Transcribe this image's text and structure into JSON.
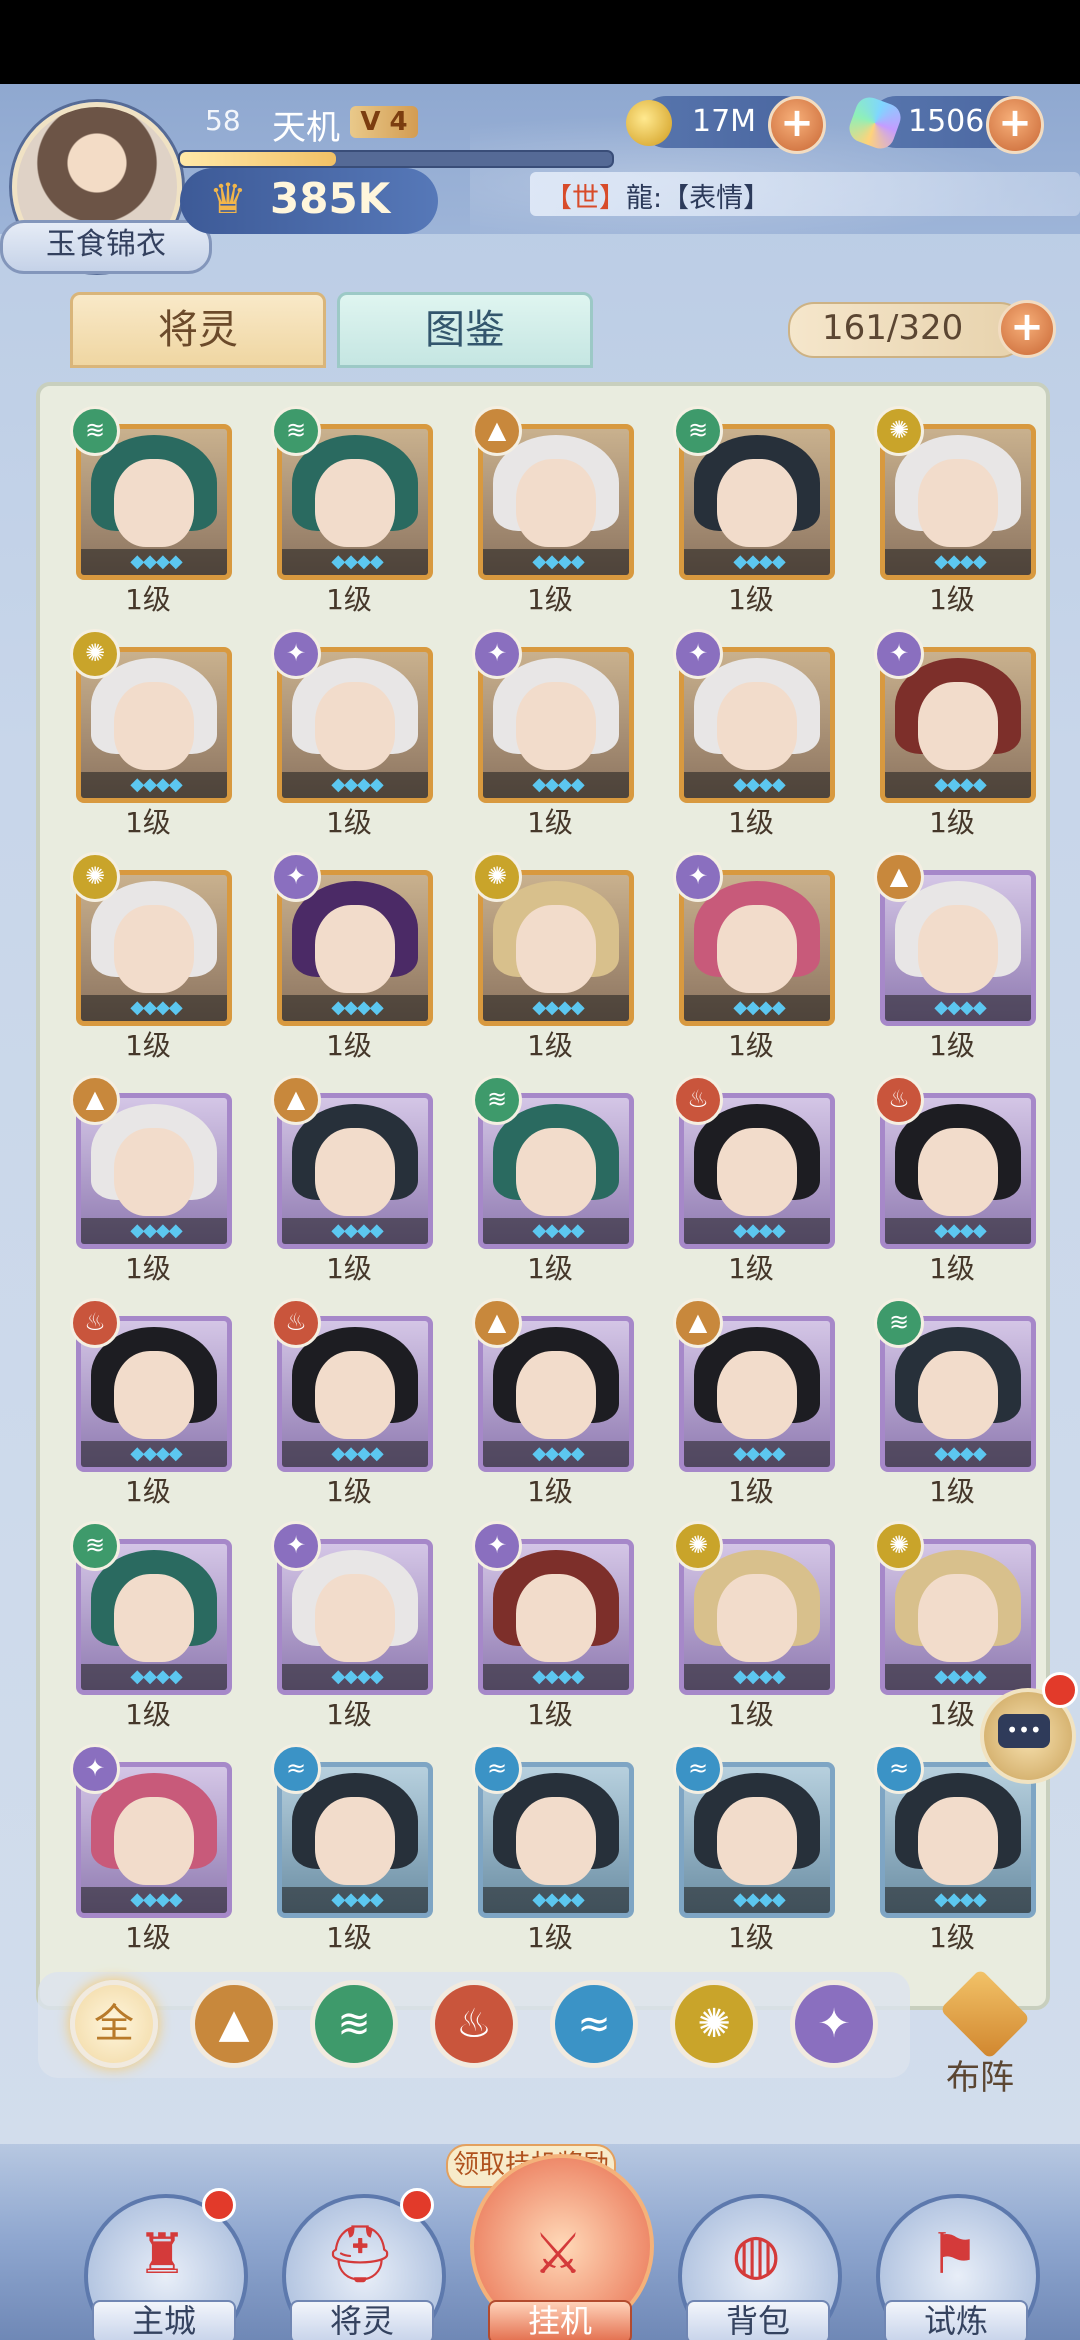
{
  "player": {
    "level": "58",
    "name": "天机",
    "vip": "V 4",
    "xp_fraction": 0.36,
    "power": "385K",
    "avatar_name": "玉食锦衣"
  },
  "resources": {
    "coins": "17M",
    "gems": "1506"
  },
  "chat": {
    "channel": "【世】",
    "text": "龍:【表情】"
  },
  "tabs": {
    "active": "将灵",
    "inactive": "图鉴"
  },
  "capacity": "161/320",
  "heroes": [
    {
      "level": "1级",
      "element": "wind",
      "frame": "gold",
      "hair": "teal"
    },
    {
      "level": "1级",
      "element": "wind",
      "frame": "gold",
      "hair": "teal"
    },
    {
      "level": "1级",
      "element": "mountain",
      "frame": "gold",
      "hair": "white"
    },
    {
      "level": "1级",
      "element": "wind",
      "frame": "gold",
      "hair": "dark"
    },
    {
      "level": "1级",
      "element": "sun",
      "frame": "gold",
      "hair": "white"
    },
    {
      "level": "1级",
      "element": "sun",
      "frame": "gold",
      "hair": "white"
    },
    {
      "level": "1级",
      "element": "star",
      "frame": "gold",
      "hair": "white"
    },
    {
      "level": "1级",
      "element": "star",
      "frame": "gold",
      "hair": "white"
    },
    {
      "level": "1级",
      "element": "star",
      "frame": "gold",
      "hair": "white"
    },
    {
      "level": "1级",
      "element": "star",
      "frame": "gold",
      "hair": "red"
    },
    {
      "level": "1级",
      "element": "sun",
      "frame": "gold",
      "hair": "white"
    },
    {
      "level": "1级",
      "element": "star",
      "frame": "gold",
      "hair": "purple"
    },
    {
      "level": "1级",
      "element": "sun",
      "frame": "gold",
      "hair": "gold"
    },
    {
      "level": "1级",
      "element": "star",
      "frame": "gold",
      "hair": "pink"
    },
    {
      "level": "1级",
      "element": "mountain",
      "frame": "purple",
      "hair": "white"
    },
    {
      "level": "1级",
      "element": "mountain",
      "frame": "purple",
      "hair": "white"
    },
    {
      "level": "1级",
      "element": "mountain",
      "frame": "purple",
      "hair": "dark"
    },
    {
      "level": "1级",
      "element": "wind",
      "frame": "purple",
      "hair": "teal"
    },
    {
      "level": "1级",
      "element": "fire",
      "frame": "purple",
      "hair": "black"
    },
    {
      "level": "1级",
      "element": "fire",
      "frame": "purple",
      "hair": "black"
    },
    {
      "level": "1级",
      "element": "fire",
      "frame": "purple",
      "hair": "black"
    },
    {
      "level": "1级",
      "element": "fire",
      "frame": "purple",
      "hair": "black"
    },
    {
      "level": "1级",
      "element": "mountain",
      "frame": "purple",
      "hair": "black"
    },
    {
      "level": "1级",
      "element": "mountain",
      "frame": "purple",
      "hair": "black"
    },
    {
      "level": "1级",
      "element": "wind",
      "frame": "purple",
      "hair": "dark"
    },
    {
      "level": "1级",
      "element": "wind",
      "frame": "purple",
      "hair": "teal"
    },
    {
      "level": "1级",
      "element": "star",
      "frame": "purple",
      "hair": "white"
    },
    {
      "level": "1级",
      "element": "star",
      "frame": "purple",
      "hair": "red"
    },
    {
      "level": "1级",
      "element": "sun",
      "frame": "purple",
      "hair": "gold"
    },
    {
      "level": "1级",
      "element": "sun",
      "frame": "purple",
      "hair": "gold"
    },
    {
      "level": "1级",
      "element": "star",
      "frame": "purple",
      "hair": "pink"
    },
    {
      "level": "1级",
      "element": "water",
      "frame": "blue",
      "hair": "dark"
    },
    {
      "level": "1级",
      "element": "water",
      "frame": "blue",
      "hair": "dark"
    },
    {
      "level": "1级",
      "element": "water",
      "frame": "blue",
      "hair": "dark"
    },
    {
      "level": "1级",
      "element": "water",
      "frame": "blue",
      "hair": "dark"
    }
  ],
  "filters": {
    "all_label": "全",
    "items": [
      "all",
      "mountain",
      "wind",
      "fire",
      "water",
      "sun",
      "star"
    ]
  },
  "formation_label": "布阵",
  "idle_reward_label": "领取挂机奖励",
  "nav": [
    {
      "label": "主城",
      "icon": "castle-icon",
      "badge": true
    },
    {
      "label": "将灵",
      "icon": "helmet-icon",
      "badge": true
    },
    {
      "label": "挂机",
      "icon": "crossed-swords-icon",
      "badge": false
    },
    {
      "label": "背包",
      "icon": "bag-icon",
      "badge": false
    },
    {
      "label": "试炼",
      "icon": "banner-icon",
      "badge": false
    }
  ],
  "colors": {
    "accent": "#d8993f",
    "header": "#9db4d8",
    "panel": "#e9ecdf"
  }
}
